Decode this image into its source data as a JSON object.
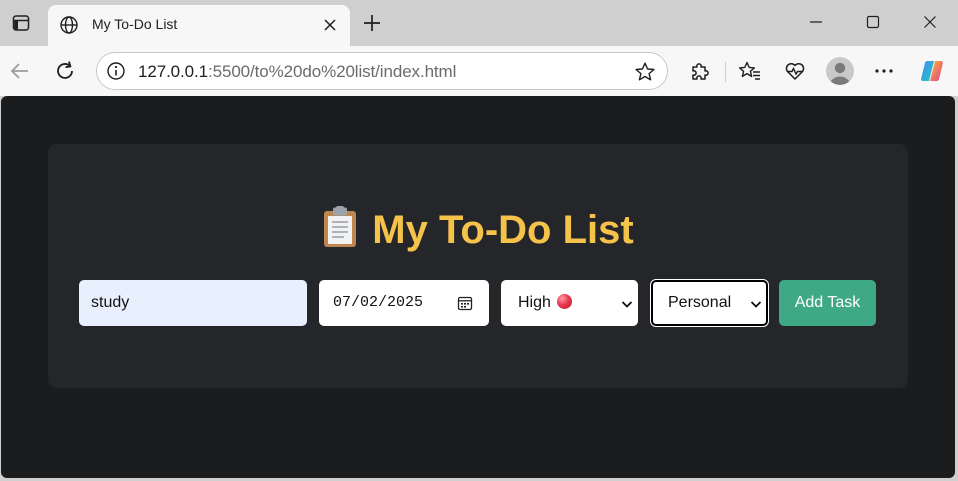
{
  "browser": {
    "tab": {
      "title": "My To-Do List"
    },
    "address_bar": {
      "host": "127.0.0.1",
      "rest": ":5500/to%20do%20list/index.html"
    }
  },
  "page": {
    "heading": "My To-Do List",
    "task_input": {
      "value": "study"
    },
    "due_date": {
      "value": "07/02/2025"
    },
    "priority": {
      "selected": "High",
      "dot_color": "#e8384f"
    },
    "category": {
      "selected": "Personal"
    },
    "add_button": "Add Task"
  },
  "colors": {
    "page_background": "#1b1c1e",
    "card_background": "#25262a",
    "heading": "#f5c24a",
    "add_button": "#3fa885",
    "task_input_background": "#e8f0fe"
  },
  "icons": {
    "tab_actions": "tab-actions-icon",
    "favicon": "globe-icon",
    "back": "back-arrow-icon",
    "refresh": "refresh-icon",
    "site_info": "info-icon",
    "favorite": "star-icon",
    "extensions": "puzzle-icon",
    "favorites": "favorites-icon",
    "performance": "heartbeat-icon",
    "profile": "avatar-icon",
    "more": "more-icon",
    "copilot": "copilot-icon",
    "heading": "clipboard-icon",
    "calendar": "calendar-icon"
  }
}
